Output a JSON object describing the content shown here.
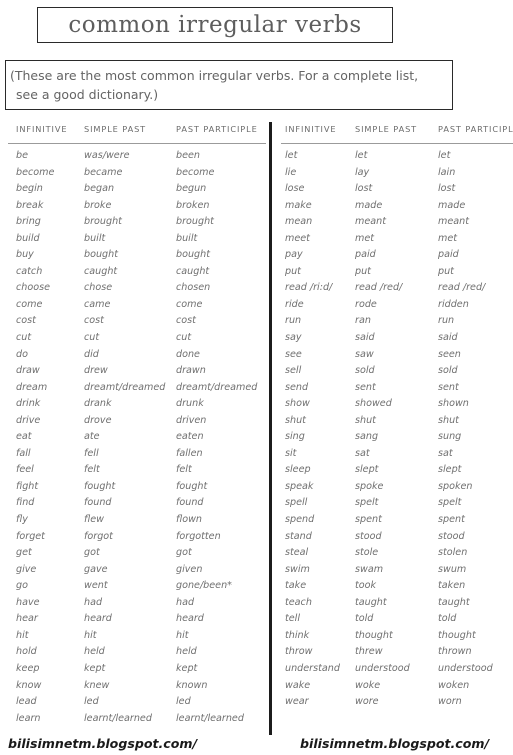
{
  "title": "common irregular verbs",
  "note": {
    "line1": "(These are the most common irregular verbs. For a complete list,",
    "line2": "see a good dictionary.)"
  },
  "headers": {
    "infinitive": "INFINITIVE",
    "simple_past": "SIMPLE PAST",
    "past_participle": "PAST PARTICIPLE"
  },
  "footer": {
    "left": "bilisimnetm.blogspot.com/",
    "right": "bilisimnetm.blogspot.com/"
  },
  "colors": {
    "ink": "#707070",
    "border": "#2a2a2a",
    "divider": "#1c1c1c",
    "watermark": "#1a1a1a"
  },
  "left_column": [
    {
      "infinitive": "be",
      "simple_past": "was/were",
      "past_participle": "been"
    },
    {
      "infinitive": "become",
      "simple_past": "became",
      "past_participle": "become"
    },
    {
      "infinitive": "begin",
      "simple_past": "began",
      "past_participle": "begun"
    },
    {
      "infinitive": "break",
      "simple_past": "broke",
      "past_participle": "broken"
    },
    {
      "infinitive": "bring",
      "simple_past": "brought",
      "past_participle": "brought"
    },
    {
      "infinitive": "build",
      "simple_past": "built",
      "past_participle": "built"
    },
    {
      "infinitive": "buy",
      "simple_past": "bought",
      "past_participle": "bought"
    },
    {
      "infinitive": "catch",
      "simple_past": "caught",
      "past_participle": "caught"
    },
    {
      "infinitive": "choose",
      "simple_past": "chose",
      "past_participle": "chosen"
    },
    {
      "infinitive": "come",
      "simple_past": "came",
      "past_participle": "come"
    },
    {
      "infinitive": "cost",
      "simple_past": "cost",
      "past_participle": "cost"
    },
    {
      "infinitive": "cut",
      "simple_past": "cut",
      "past_participle": "cut"
    },
    {
      "infinitive": "do",
      "simple_past": "did",
      "past_participle": "done"
    },
    {
      "infinitive": "draw",
      "simple_past": "drew",
      "past_participle": "drawn"
    },
    {
      "infinitive": "dream",
      "simple_past": "dreamt/dreamed",
      "past_participle": "dreamt/dreamed"
    },
    {
      "infinitive": "drink",
      "simple_past": "drank",
      "past_participle": "drunk"
    },
    {
      "infinitive": "drive",
      "simple_past": "drove",
      "past_participle": "driven"
    },
    {
      "infinitive": "eat",
      "simple_past": "ate",
      "past_participle": "eaten"
    },
    {
      "infinitive": "fall",
      "simple_past": "fell",
      "past_participle": "fallen"
    },
    {
      "infinitive": "feel",
      "simple_past": "felt",
      "past_participle": "felt"
    },
    {
      "infinitive": "fight",
      "simple_past": "fought",
      "past_participle": "fought"
    },
    {
      "infinitive": "find",
      "simple_past": "found",
      "past_participle": "found"
    },
    {
      "infinitive": "fly",
      "simple_past": "flew",
      "past_participle": "flown"
    },
    {
      "infinitive": "forget",
      "simple_past": "forgot",
      "past_participle": "forgotten"
    },
    {
      "infinitive": "get",
      "simple_past": "got",
      "past_participle": "got"
    },
    {
      "infinitive": "give",
      "simple_past": "gave",
      "past_participle": "given"
    },
    {
      "infinitive": "go",
      "simple_past": "went",
      "past_participle": "gone/been*"
    },
    {
      "infinitive": "have",
      "simple_past": "had",
      "past_participle": "had"
    },
    {
      "infinitive": "hear",
      "simple_past": "heard",
      "past_participle": "heard"
    },
    {
      "infinitive": "hit",
      "simple_past": "hit",
      "past_participle": "hit"
    },
    {
      "infinitive": "hold",
      "simple_past": "held",
      "past_participle": "held"
    },
    {
      "infinitive": "keep",
      "simple_past": "kept",
      "past_participle": "kept"
    },
    {
      "infinitive": "know",
      "simple_past": "knew",
      "past_participle": "known"
    },
    {
      "infinitive": "lead",
      "simple_past": "led",
      "past_participle": "led"
    },
    {
      "infinitive": "learn",
      "simple_past": "learnt/learned",
      "past_participle": "learnt/learned"
    }
  ],
  "right_column": [
    {
      "infinitive": "let",
      "simple_past": "let",
      "past_participle": "let"
    },
    {
      "infinitive": "lie",
      "simple_past": "lay",
      "past_participle": "lain"
    },
    {
      "infinitive": "lose",
      "simple_past": "lost",
      "past_participle": "lost"
    },
    {
      "infinitive": "make",
      "simple_past": "made",
      "past_participle": "made"
    },
    {
      "infinitive": "mean",
      "simple_past": "meant",
      "past_participle": "meant"
    },
    {
      "infinitive": "meet",
      "simple_past": "met",
      "past_participle": "met"
    },
    {
      "infinitive": "pay",
      "simple_past": "paid",
      "past_participle": "paid"
    },
    {
      "infinitive": "put",
      "simple_past": "put",
      "past_participle": "put"
    },
    {
      "infinitive": "read /ri:d/",
      "simple_past": "read /red/",
      "past_participle": "read /red/"
    },
    {
      "infinitive": "ride",
      "simple_past": "rode",
      "past_participle": "ridden"
    },
    {
      "infinitive": "run",
      "simple_past": "ran",
      "past_participle": "run"
    },
    {
      "infinitive": "say",
      "simple_past": "said",
      "past_participle": "said"
    },
    {
      "infinitive": "see",
      "simple_past": "saw",
      "past_participle": "seen"
    },
    {
      "infinitive": "sell",
      "simple_past": "sold",
      "past_participle": "sold"
    },
    {
      "infinitive": "send",
      "simple_past": "sent",
      "past_participle": "sent"
    },
    {
      "infinitive": "show",
      "simple_past": "showed",
      "past_participle": "shown"
    },
    {
      "infinitive": "shut",
      "simple_past": "shut",
      "past_participle": "shut"
    },
    {
      "infinitive": "sing",
      "simple_past": "sang",
      "past_participle": "sung"
    },
    {
      "infinitive": "sit",
      "simple_past": "sat",
      "past_participle": "sat"
    },
    {
      "infinitive": "sleep",
      "simple_past": "slept",
      "past_participle": "slept"
    },
    {
      "infinitive": "speak",
      "simple_past": "spoke",
      "past_participle": "spoken"
    },
    {
      "infinitive": "spell",
      "simple_past": "spelt",
      "past_participle": "spelt"
    },
    {
      "infinitive": "spend",
      "simple_past": "spent",
      "past_participle": "spent"
    },
    {
      "infinitive": "stand",
      "simple_past": "stood",
      "past_participle": "stood"
    },
    {
      "infinitive": "steal",
      "simple_past": "stole",
      "past_participle": "stolen"
    },
    {
      "infinitive": "swim",
      "simple_past": "swam",
      "past_participle": "swum"
    },
    {
      "infinitive": "take",
      "simple_past": "took",
      "past_participle": "taken"
    },
    {
      "infinitive": "teach",
      "simple_past": "taught",
      "past_participle": "taught"
    },
    {
      "infinitive": "tell",
      "simple_past": "told",
      "past_participle": "told"
    },
    {
      "infinitive": "think",
      "simple_past": "thought",
      "past_participle": "thought"
    },
    {
      "infinitive": "throw",
      "simple_past": "threw",
      "past_participle": "thrown"
    },
    {
      "infinitive": "understand",
      "simple_past": "understood",
      "past_participle": "understood"
    },
    {
      "infinitive": "wake",
      "simple_past": "woke",
      "past_participle": "woken"
    },
    {
      "infinitive": "wear",
      "simple_past": "wore",
      "past_participle": "worn"
    }
  ]
}
